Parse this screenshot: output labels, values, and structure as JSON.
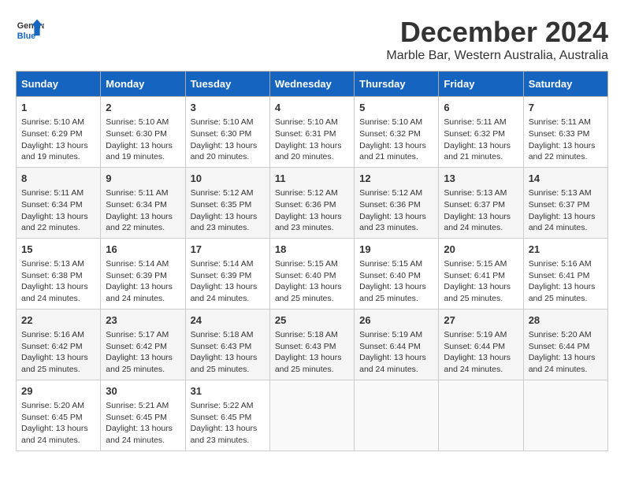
{
  "header": {
    "logo_line1": "General",
    "logo_line2": "Blue",
    "title": "December 2024",
    "subtitle": "Marble Bar, Western Australia, Australia"
  },
  "calendar": {
    "days_of_week": [
      "Sunday",
      "Monday",
      "Tuesday",
      "Wednesday",
      "Thursday",
      "Friday",
      "Saturday"
    ],
    "weeks": [
      [
        null,
        null,
        null,
        null,
        null,
        null,
        null
      ]
    ]
  },
  "days": {
    "day1": {
      "num": "1",
      "sunrise": "Sunrise: 5:10 AM",
      "sunset": "Sunset: 6:29 PM",
      "daylight": "Daylight: 13 hours and 19 minutes."
    },
    "day2": {
      "num": "2",
      "sunrise": "Sunrise: 5:10 AM",
      "sunset": "Sunset: 6:30 PM",
      "daylight": "Daylight: 13 hours and 19 minutes."
    },
    "day3": {
      "num": "3",
      "sunrise": "Sunrise: 5:10 AM",
      "sunset": "Sunset: 6:30 PM",
      "daylight": "Daylight: 13 hours and 20 minutes."
    },
    "day4": {
      "num": "4",
      "sunrise": "Sunrise: 5:10 AM",
      "sunset": "Sunset: 6:31 PM",
      "daylight": "Daylight: 13 hours and 20 minutes."
    },
    "day5": {
      "num": "5",
      "sunrise": "Sunrise: 5:10 AM",
      "sunset": "Sunset: 6:32 PM",
      "daylight": "Daylight: 13 hours and 21 minutes."
    },
    "day6": {
      "num": "6",
      "sunrise": "Sunrise: 5:11 AM",
      "sunset": "Sunset: 6:32 PM",
      "daylight": "Daylight: 13 hours and 21 minutes."
    },
    "day7": {
      "num": "7",
      "sunrise": "Sunrise: 5:11 AM",
      "sunset": "Sunset: 6:33 PM",
      "daylight": "Daylight: 13 hours and 22 minutes."
    },
    "day8": {
      "num": "8",
      "sunrise": "Sunrise: 5:11 AM",
      "sunset": "Sunset: 6:34 PM",
      "daylight": "Daylight: 13 hours and 22 minutes."
    },
    "day9": {
      "num": "9",
      "sunrise": "Sunrise: 5:11 AM",
      "sunset": "Sunset: 6:34 PM",
      "daylight": "Daylight: 13 hours and 22 minutes."
    },
    "day10": {
      "num": "10",
      "sunrise": "Sunrise: 5:12 AM",
      "sunset": "Sunset: 6:35 PM",
      "daylight": "Daylight: 13 hours and 23 minutes."
    },
    "day11": {
      "num": "11",
      "sunrise": "Sunrise: 5:12 AM",
      "sunset": "Sunset: 6:36 PM",
      "daylight": "Daylight: 13 hours and 23 minutes."
    },
    "day12": {
      "num": "12",
      "sunrise": "Sunrise: 5:12 AM",
      "sunset": "Sunset: 6:36 PM",
      "daylight": "Daylight: 13 hours and 23 minutes."
    },
    "day13": {
      "num": "13",
      "sunrise": "Sunrise: 5:13 AM",
      "sunset": "Sunset: 6:37 PM",
      "daylight": "Daylight: 13 hours and 24 minutes."
    },
    "day14": {
      "num": "14",
      "sunrise": "Sunrise: 5:13 AM",
      "sunset": "Sunset: 6:37 PM",
      "daylight": "Daylight: 13 hours and 24 minutes."
    },
    "day15": {
      "num": "15",
      "sunrise": "Sunrise: 5:13 AM",
      "sunset": "Sunset: 6:38 PM",
      "daylight": "Daylight: 13 hours and 24 minutes."
    },
    "day16": {
      "num": "16",
      "sunrise": "Sunrise: 5:14 AM",
      "sunset": "Sunset: 6:39 PM",
      "daylight": "Daylight: 13 hours and 24 minutes."
    },
    "day17": {
      "num": "17",
      "sunrise": "Sunrise: 5:14 AM",
      "sunset": "Sunset: 6:39 PM",
      "daylight": "Daylight: 13 hours and 24 minutes."
    },
    "day18": {
      "num": "18",
      "sunrise": "Sunrise: 5:15 AM",
      "sunset": "Sunset: 6:40 PM",
      "daylight": "Daylight: 13 hours and 25 minutes."
    },
    "day19": {
      "num": "19",
      "sunrise": "Sunrise: 5:15 AM",
      "sunset": "Sunset: 6:40 PM",
      "daylight": "Daylight: 13 hours and 25 minutes."
    },
    "day20": {
      "num": "20",
      "sunrise": "Sunrise: 5:15 AM",
      "sunset": "Sunset: 6:41 PM",
      "daylight": "Daylight: 13 hours and 25 minutes."
    },
    "day21": {
      "num": "21",
      "sunrise": "Sunrise: 5:16 AM",
      "sunset": "Sunset: 6:41 PM",
      "daylight": "Daylight: 13 hours and 25 minutes."
    },
    "day22": {
      "num": "22",
      "sunrise": "Sunrise: 5:16 AM",
      "sunset": "Sunset: 6:42 PM",
      "daylight": "Daylight: 13 hours and 25 minutes."
    },
    "day23": {
      "num": "23",
      "sunrise": "Sunrise: 5:17 AM",
      "sunset": "Sunset: 6:42 PM",
      "daylight": "Daylight: 13 hours and 25 minutes."
    },
    "day24": {
      "num": "24",
      "sunrise": "Sunrise: 5:18 AM",
      "sunset": "Sunset: 6:43 PM",
      "daylight": "Daylight: 13 hours and 25 minutes."
    },
    "day25": {
      "num": "25",
      "sunrise": "Sunrise: 5:18 AM",
      "sunset": "Sunset: 6:43 PM",
      "daylight": "Daylight: 13 hours and 25 minutes."
    },
    "day26": {
      "num": "26",
      "sunrise": "Sunrise: 5:19 AM",
      "sunset": "Sunset: 6:44 PM",
      "daylight": "Daylight: 13 hours and 24 minutes."
    },
    "day27": {
      "num": "27",
      "sunrise": "Sunrise: 5:19 AM",
      "sunset": "Sunset: 6:44 PM",
      "daylight": "Daylight: 13 hours and 24 minutes."
    },
    "day28": {
      "num": "28",
      "sunrise": "Sunrise: 5:20 AM",
      "sunset": "Sunset: 6:44 PM",
      "daylight": "Daylight: 13 hours and 24 minutes."
    },
    "day29": {
      "num": "29",
      "sunrise": "Sunrise: 5:20 AM",
      "sunset": "Sunset: 6:45 PM",
      "daylight": "Daylight: 13 hours and 24 minutes."
    },
    "day30": {
      "num": "30",
      "sunrise": "Sunrise: 5:21 AM",
      "sunset": "Sunset: 6:45 PM",
      "daylight": "Daylight: 13 hours and 24 minutes."
    },
    "day31": {
      "num": "31",
      "sunrise": "Sunrise: 5:22 AM",
      "sunset": "Sunset: 6:45 PM",
      "daylight": "Daylight: 13 hours and 23 minutes."
    }
  },
  "col_headers": {
    "sun": "Sunday",
    "mon": "Monday",
    "tue": "Tuesday",
    "wed": "Wednesday",
    "thu": "Thursday",
    "fri": "Friday",
    "sat": "Saturday"
  }
}
